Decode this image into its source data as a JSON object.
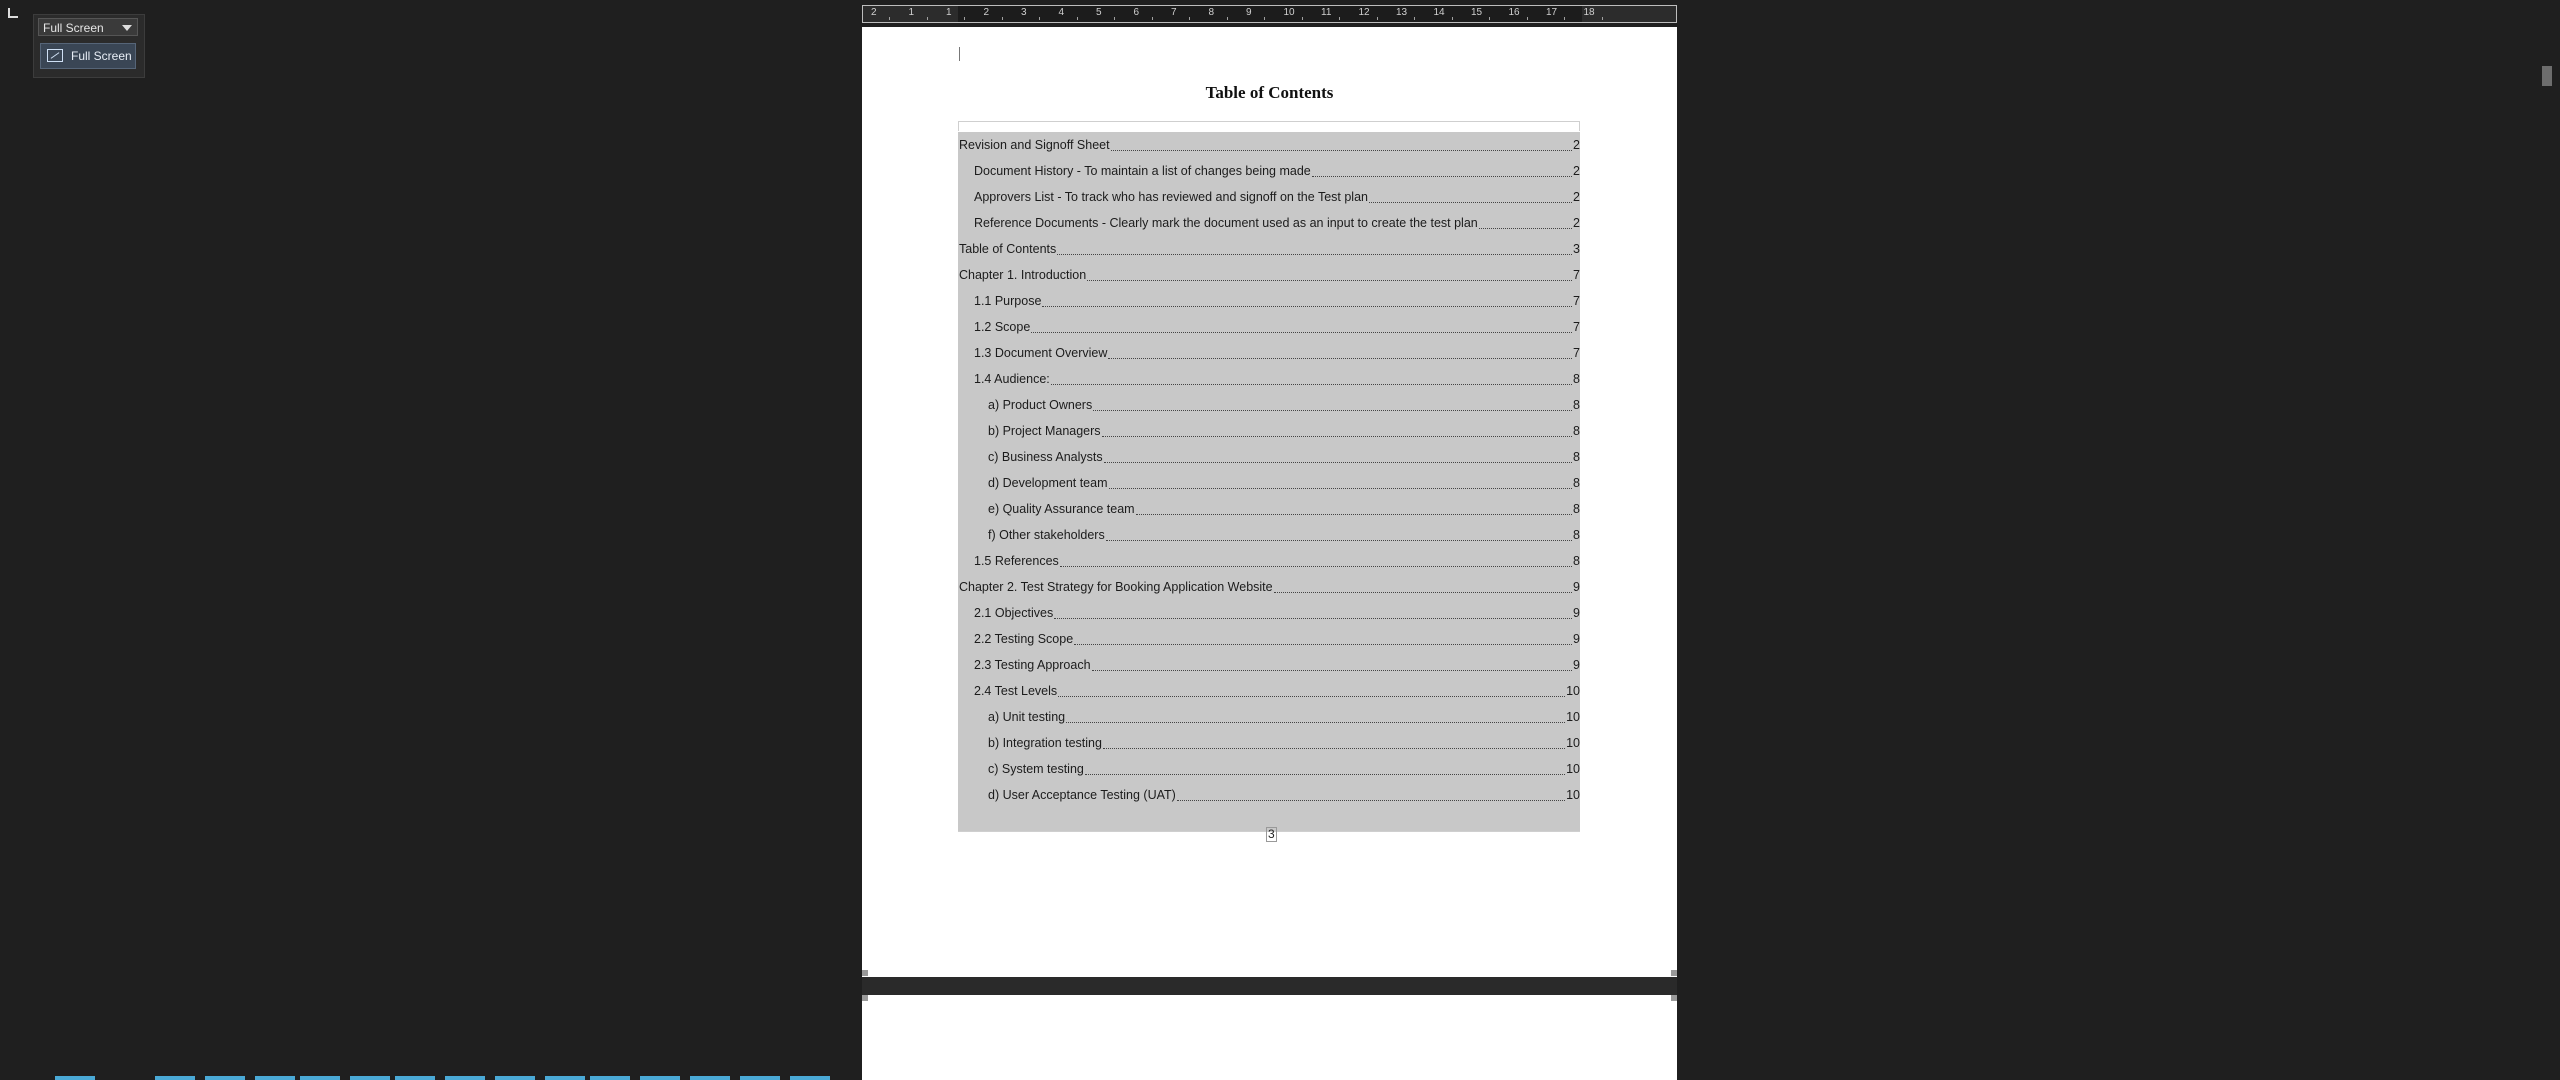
{
  "fullscreen_panel": {
    "select_value": "Full Screen",
    "button_label": "Full Screen"
  },
  "ruler": {
    "labels": [
      "2",
      "1",
      "1",
      "2",
      "3",
      "4",
      "5",
      "6",
      "7",
      "8",
      "9",
      "10",
      "11",
      "12",
      "13",
      "14",
      "15",
      "16",
      "17",
      "18"
    ]
  },
  "document": {
    "toc_title": "Table of Contents",
    "page_number": "3",
    "toc": [
      {
        "text": "Revision and Signoff Sheet",
        "page": "2",
        "level": 0
      },
      {
        "text": "Document History - To maintain a list of changes being made",
        "page": "2",
        "level": 1
      },
      {
        "text": "Approvers List - To track who has reviewed and signoff on the Test plan",
        "page": "2",
        "level": 1
      },
      {
        "text": "Reference Documents - Clearly mark the document used as an input to create the test plan",
        "page": "2",
        "level": 1
      },
      {
        "text": "Table of Contents",
        "page": "3",
        "level": 0
      },
      {
        "text": "Chapter 1. Introduction",
        "page": "7",
        "level": 0
      },
      {
        "text": "1.1 Purpose",
        "page": "7",
        "level": 1
      },
      {
        "text": "1.2 Scope",
        "page": "7",
        "level": 1
      },
      {
        "text": "1.3 Document Overview",
        "page": "7",
        "level": 1
      },
      {
        "text": "1.4 Audience:",
        "page": "8",
        "level": 1
      },
      {
        "text": "a) Product Owners",
        "page": "8",
        "level": 2
      },
      {
        "text": "b) Project Managers",
        "page": "8",
        "level": 2
      },
      {
        "text": "c) Business Analysts",
        "page": "8",
        "level": 2
      },
      {
        "text": "d) Development team",
        "page": "8",
        "level": 2
      },
      {
        "text": "e) Quality Assurance team",
        "page": "8",
        "level": 2
      },
      {
        "text": "f) Other stakeholders",
        "page": "8",
        "level": 2
      },
      {
        "text": "1.5 References",
        "page": "8",
        "level": 1
      },
      {
        "text": "Chapter 2. Test Strategy for Booking Application Website",
        "page": "9",
        "level": 0
      },
      {
        "text": "2.1 Objectives",
        "page": "9",
        "level": 1
      },
      {
        "text": "2.2 Testing Scope",
        "page": "9",
        "level": 1
      },
      {
        "text": "2.3 Testing Approach",
        "page": "9",
        "level": 1
      },
      {
        "text": "2.4 Test Levels",
        "page": "10",
        "level": 1
      },
      {
        "text": "a) Unit testing",
        "page": "10",
        "level": 2
      },
      {
        "text": "b) Integration testing",
        "page": "10",
        "level": 2
      },
      {
        "text": "c) System testing",
        "page": "10",
        "level": 2
      },
      {
        "text": "d) User Acceptance Testing (UAT)",
        "page": "10",
        "level": 2
      }
    ]
  }
}
